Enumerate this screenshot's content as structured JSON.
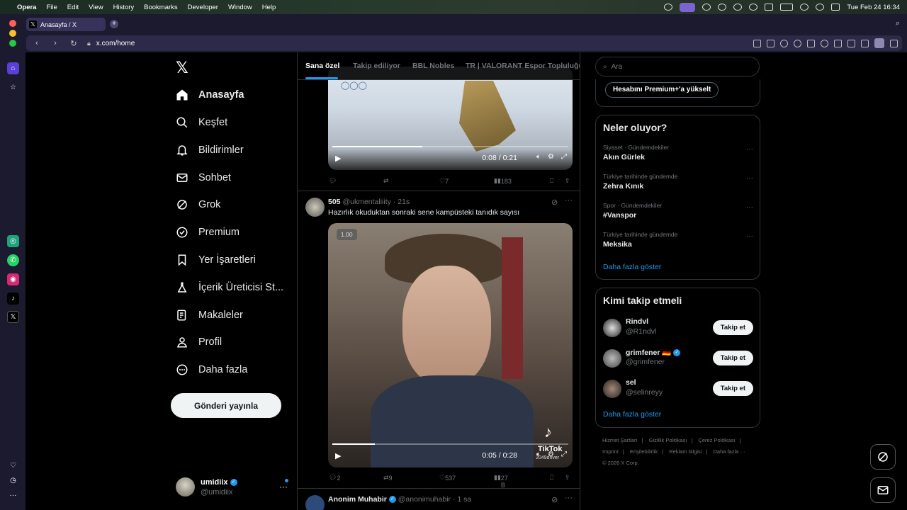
{
  "menubar": {
    "app": "Opera",
    "menus": [
      "File",
      "Edit",
      "View",
      "History",
      "Bookmarks",
      "Developer",
      "Window",
      "Help"
    ],
    "datetime": "Tue Feb 24  16:34"
  },
  "browser": {
    "tab_title": "Anasayfa / X",
    "url": "x.com/home"
  },
  "nav": {
    "items": [
      {
        "label": "Anasayfa",
        "icon": "home-icon"
      },
      {
        "label": "Keşfet",
        "icon": "search-icon"
      },
      {
        "label": "Bildirimler",
        "icon": "bell-icon"
      },
      {
        "label": "Sohbet",
        "icon": "mail-icon"
      },
      {
        "label": "Grok",
        "icon": "grok-icon"
      },
      {
        "label": "Premium",
        "icon": "verified-icon"
      },
      {
        "label": "Yer İşaretleri",
        "icon": "bookmark-icon"
      },
      {
        "label": "İçerik Üreticisi St...",
        "icon": "flask-icon"
      },
      {
        "label": "Makaleler",
        "icon": "article-icon"
      },
      {
        "label": "Profil",
        "icon": "person-icon"
      },
      {
        "label": "Daha fazla",
        "icon": "more-circle-icon"
      }
    ],
    "post_button": "Gönderi yayınla"
  },
  "account": {
    "name": "umidiix",
    "handle": "@umidiix"
  },
  "feed": {
    "tabs": [
      "Sana özel",
      "Takip ediliyor",
      "BBL Nobles",
      "TR | VALORANT Espor Topluluğu"
    ],
    "tweet1": {
      "video_time": "0:08 / 0:21",
      "video_progress": 0.38,
      "likes": "7",
      "views": "183"
    },
    "tweet2": {
      "author": "505",
      "handle": "@ukmentaliiity",
      "time": "· 21s",
      "text": "Hazırlık okuduktan sonraki sene kampüsteki tanıdık sayısı",
      "speed": "1.00",
      "video_time": "0:05 / 0:28",
      "video_progress": 0.18,
      "watermark": "TikTok",
      "watermark_user": "2049driver",
      "replies": "2",
      "retweets": "9",
      "likes": "537",
      "views": "27 B"
    },
    "tweet3": {
      "author": "Anonim Muhabir",
      "handle": "@anonimuhabir",
      "time": "· 1 sa"
    }
  },
  "sidebar": {
    "search_placeholder": "Ara",
    "premium_button": "Hesabını Premium+'a yükselt",
    "trends_title": "Neler oluyor?",
    "trends": [
      {
        "meta": "Siyaset · Gündemdekiler",
        "name": "Akın Gürlek"
      },
      {
        "meta": "Türkiye tarihinde gündemde",
        "name": "Zehra Kınık"
      },
      {
        "meta": "Spor · Gündemdekiler",
        "name": "#Vanspor"
      },
      {
        "meta": "Türkiye tarihinde gündemde",
        "name": "Meksika"
      }
    ],
    "trends_more": "Daha fazla göster",
    "follow_title": "Kimi takip etmeli",
    "follow": [
      {
        "name": "Rindvl",
        "handle": "@R1ndvl",
        "button": "Takip et"
      },
      {
        "name": "grimfener 🇩🇪",
        "handle": "@grimfener",
        "button": "Takip et"
      },
      {
        "name": "sel",
        "handle": "@selinreyy",
        "button": "Takip et"
      }
    ],
    "follow_more": "Daha fazla göster",
    "footer_links": [
      "Hizmet Şartları",
      "|",
      "Gizlilik Politikası",
      "|",
      "Çerez Politikası",
      "|",
      "Imprint",
      "|",
      "Erişilebilirlik",
      "|",
      "Reklam bilgisi",
      "|",
      "Daha fazla ···"
    ],
    "copyright": "© 2026 X Corp."
  }
}
